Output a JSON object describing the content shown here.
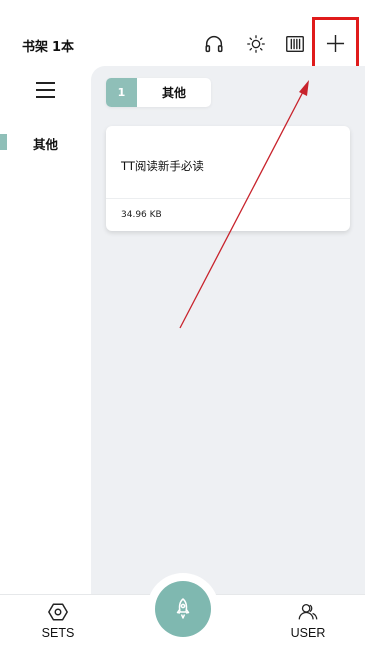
{
  "header": {
    "title": "书架",
    "book_count": "1本",
    "icons": [
      "headphones-icon",
      "brightness-icon",
      "bookshelf-icon",
      "plus-icon"
    ]
  },
  "sidebar": {
    "items": [
      {
        "label": "其他",
        "selected": true
      }
    ]
  },
  "group_tab": {
    "number": "1",
    "name": "其他"
  },
  "books": [
    {
      "title": "TT阅读新手必读",
      "size": "34.96 KB"
    }
  ],
  "bottom_nav": {
    "left_label": "SETS",
    "right_label": "USER"
  },
  "colors": {
    "accent": "#8fbfb8",
    "highlight_box": "#e01b1b",
    "annotation_arrow": "#c8232c",
    "content_bg": "#eef0f3"
  }
}
